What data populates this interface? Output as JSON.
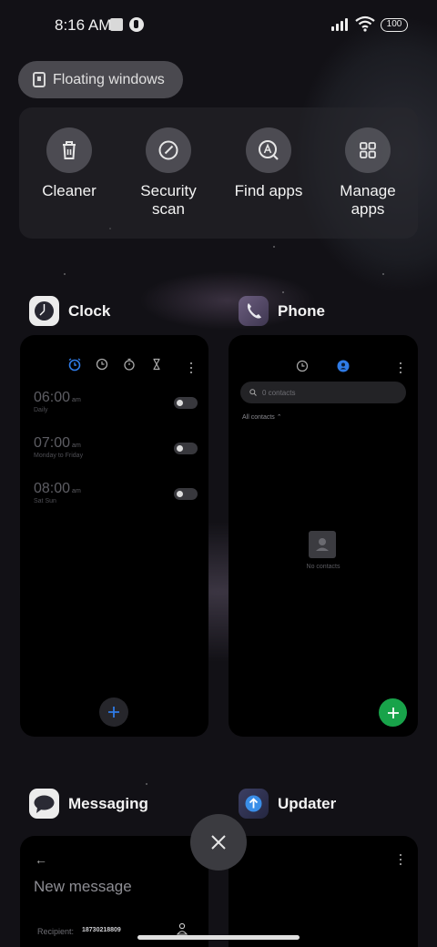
{
  "status_bar": {
    "time": "8:16 AM",
    "battery": "100"
  },
  "floating_windows": {
    "label": "Floating windows"
  },
  "tools": [
    {
      "label": "Cleaner",
      "icon": "trash-icon"
    },
    {
      "label": "Security scan",
      "icon": "security-scan-icon"
    },
    {
      "label": "Find apps",
      "icon": "find-apps-icon"
    },
    {
      "label": "Manage apps",
      "icon": "manage-apps-icon"
    }
  ],
  "clock_app": {
    "title": "Clock",
    "alarms": [
      {
        "time": "06:00",
        "ampm": "am",
        "days": "Daily"
      },
      {
        "time": "07:00",
        "ampm": "am",
        "days": "Monday to Friday"
      },
      {
        "time": "08:00",
        "ampm": "am",
        "days": "Sat Sun"
      }
    ]
  },
  "phone_app": {
    "title": "Phone",
    "search_placeholder": "0 contacts",
    "filter": "All contacts",
    "empty_text": "No contacts"
  },
  "messaging_app": {
    "title": "Messaging",
    "header": "New message",
    "recipient_label": "Recipient:",
    "recipient_number": "18730218809"
  },
  "updater_app": {
    "title": "Updater"
  },
  "colors": {
    "accent_blue": "#2f7be6",
    "phone_green": "#18a34a"
  }
}
